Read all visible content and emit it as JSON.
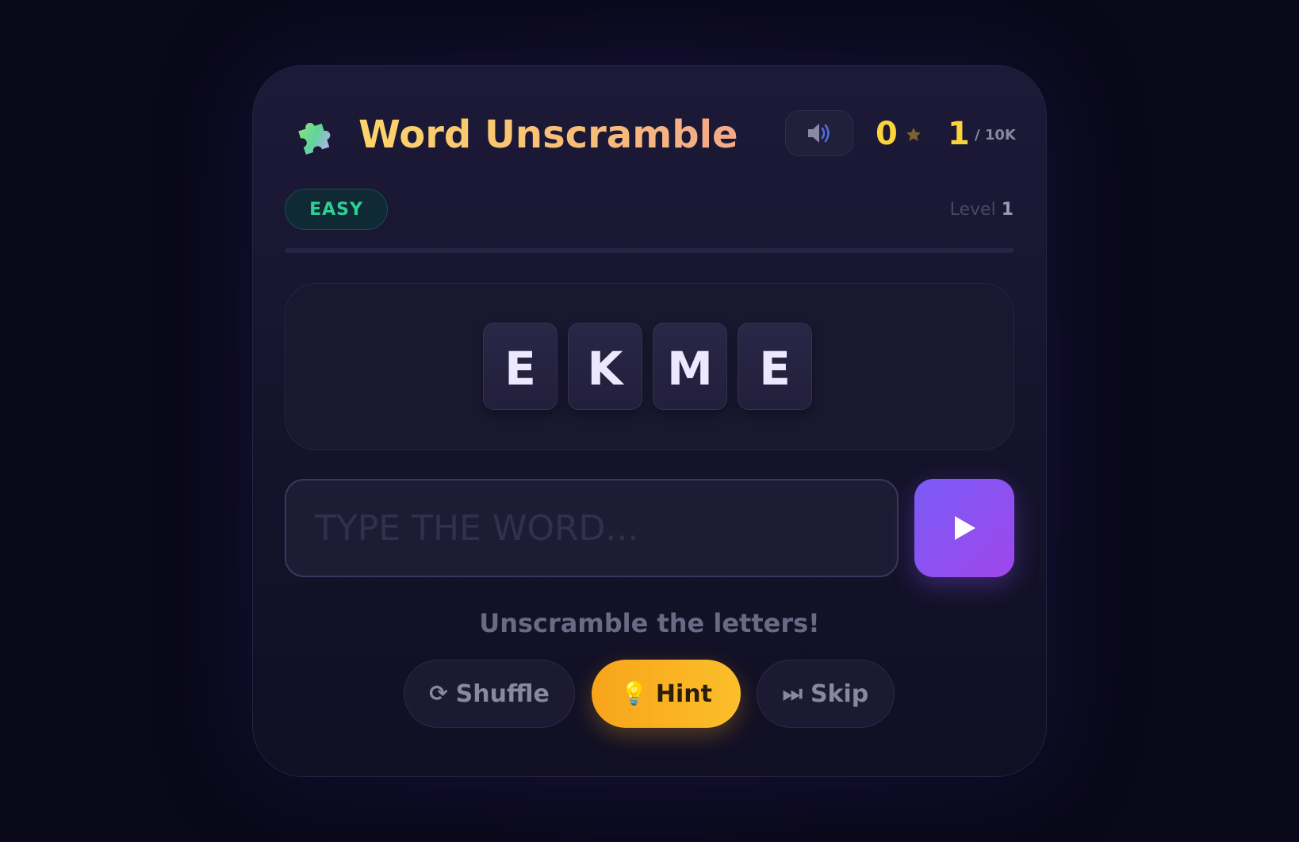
{
  "header": {
    "title": "Word Unscramble",
    "icon": "puzzle-icon",
    "sound_icon": "speaker-icon",
    "stars_value": "0",
    "star_icon": "star-icon",
    "level_current": "1",
    "level_total": "/ 10K"
  },
  "status": {
    "difficulty": "EASY",
    "level_label": "Level",
    "level_number": "1",
    "progress_fraction": 0
  },
  "puzzle": {
    "letters": [
      "E",
      "K",
      "M",
      "E"
    ]
  },
  "answer": {
    "placeholder": "TYPE THE WORD...",
    "value": "",
    "submit_icon": "play-icon"
  },
  "message": "Unscramble the letters!",
  "actions": {
    "shuffle_icon": "⟳",
    "shuffle_label": "Shuffle",
    "hint_icon": "💡",
    "hint_label": "Hint",
    "skip_icon": "⏭",
    "skip_label": "Skip"
  },
  "colors": {
    "accent": "#7b5cf0",
    "gold": "#fcd43a",
    "easy": "#2ecf95",
    "hint": "#f8a41a"
  }
}
